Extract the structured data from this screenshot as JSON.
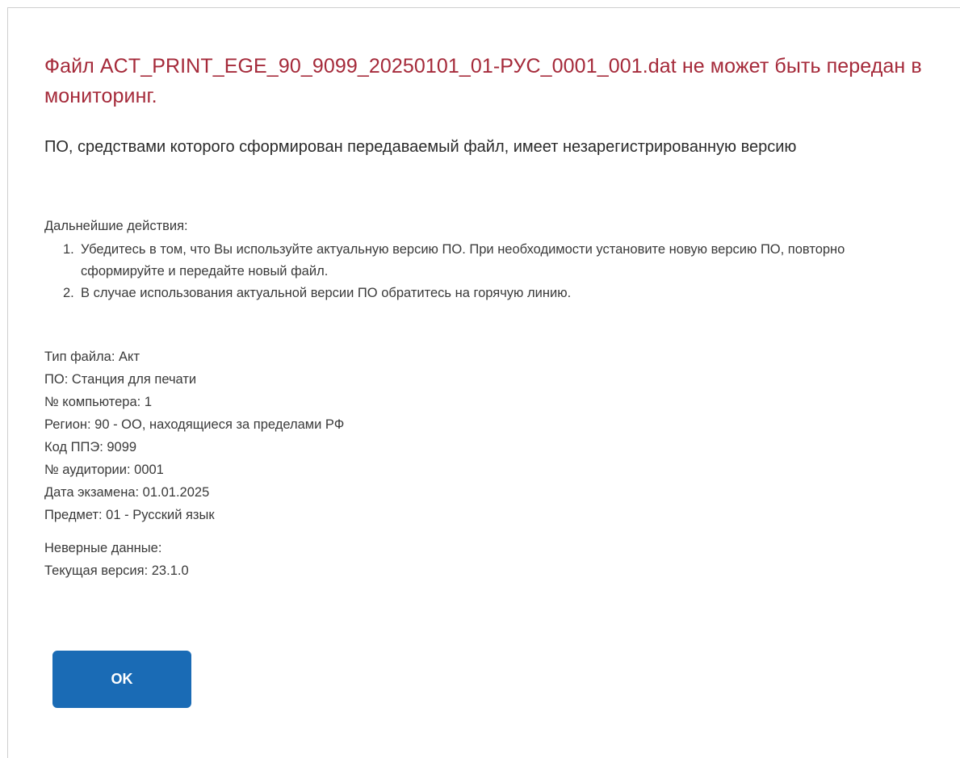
{
  "dialog": {
    "title": "Файл ACT_PRINT_EGE_90_9099_20250101_01-РУС_0001_001.dat не может быть передан в мониторинг.",
    "subtitle": "ПО, средствами которого сформирован передаваемый файл, имеет незарегистрированную версию",
    "actions_label": "Дальнейшие действия:",
    "steps": [
      {
        "num": "1.",
        "text": "Убедитесь в том, что Вы используйте актуальную версию ПО. При необходимости установите новую версию ПО, повторно сформируйте и передайте новый файл."
      },
      {
        "num": "2.",
        "text": "В случае использования актуальной версии ПО обратитесь на горячую линию."
      }
    ],
    "info": [
      "Тип файла: Акт",
      "ПО: Станция для печати",
      "№ компьютера: 1",
      "Регион: 90 - ОО, находящиеся за пределами РФ",
      "Код ППЭ: 9099",
      "№ аудитории: 0001",
      "Дата экзамена: 01.01.2025",
      "Предмет: 01 - Русский язык"
    ],
    "errors": [
      "Неверные данные:",
      "Текущая версия: 23.1.0"
    ],
    "ok_label": "OK"
  },
  "colors": {
    "title": "#a52a3a",
    "button": "#1a6bb5"
  }
}
